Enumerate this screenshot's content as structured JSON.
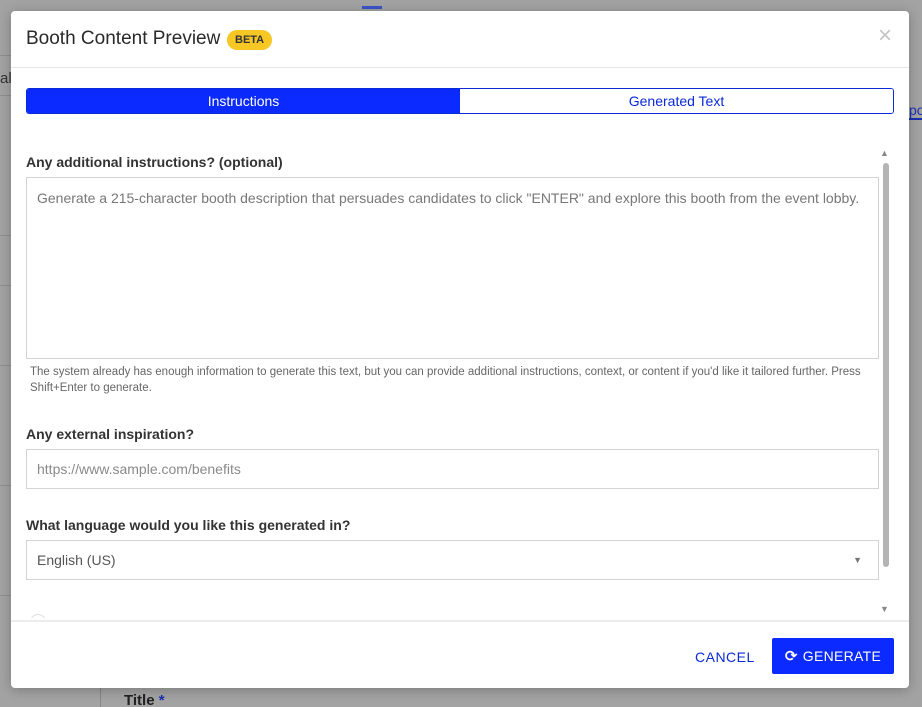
{
  "background": {
    "left_fragment": "al",
    "right_fragment": "po",
    "bottom_label": "Title",
    "bottom_required": "*"
  },
  "modal": {
    "title": "Booth Content Preview",
    "badge": "BETA",
    "close_glyph": "×"
  },
  "tabs": [
    {
      "label": "Instructions",
      "active": true
    },
    {
      "label": "Generated Text",
      "active": false
    }
  ],
  "form": {
    "instructions_label": "Any additional instructions? (optional)",
    "instructions_value": "Generate a 215-character booth description that persuades candidates to click \"ENTER\" and explore this booth from the event lobby.",
    "instructions_hint": "The system already has enough information to generate this text, but you can provide additional instructions, context, or content if you'd like it tailored further. Press Shift+Enter to generate.",
    "inspiration_label": "Any external inspiration?",
    "inspiration_placeholder": "https://www.sample.com/benefits",
    "language_label": "What language would you like this generated in?",
    "language_value": "English (US)"
  },
  "footer": {
    "cancel_label": "CANCEL",
    "generate_label": "GENERATE"
  },
  "colors": {
    "accent": "#0a2aff",
    "badge": "#f7c726"
  },
  "icons": [
    "close-icon",
    "refresh-icon",
    "chevron-down-icon",
    "scroll-up-icon",
    "scroll-down-icon"
  ]
}
